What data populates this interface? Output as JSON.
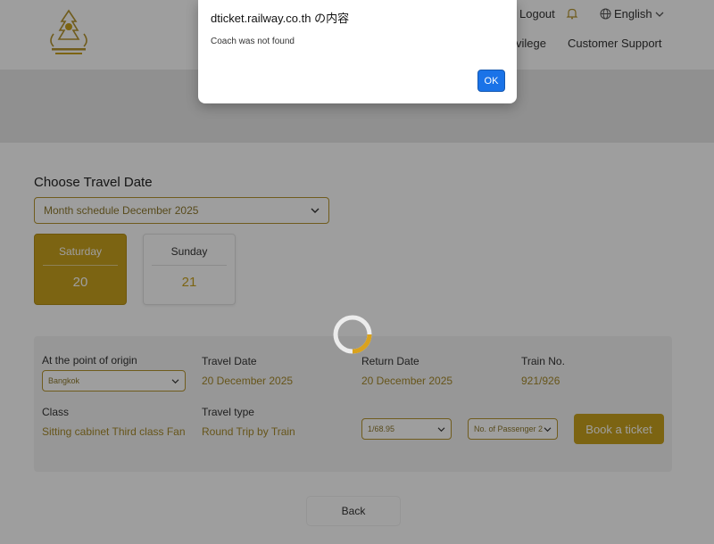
{
  "header": {
    "logout_label": "Logout",
    "language_label": "English",
    "nav_privilege_label": "vilege",
    "nav_support_label": "Customer Support"
  },
  "travel_date": {
    "section_title": "Choose Travel Date",
    "month_select_value": "Month schedule December 2025",
    "days": [
      {
        "name": "Saturday",
        "number": "20",
        "selected": true
      },
      {
        "name": "Sunday",
        "number": "21",
        "selected": false
      }
    ]
  },
  "booking": {
    "origin_label": "At the point of origin",
    "origin_value": "Bangkok",
    "travel_date_label": "Travel Date",
    "travel_date_value": "20 December 2025",
    "return_date_label": "Return Date",
    "return_date_value": "20 December 2025",
    "train_no_label": "Train No.",
    "train_no_value": "921/926",
    "class_label": "Class",
    "class_value": "Sitting cabinet Third class Fan",
    "travel_type_label": "Travel type",
    "travel_type_value": "Round Trip by Train",
    "fare_select_value": "1/68.95",
    "passenger_select_value": "No. of Passenger 2",
    "book_button_label": "Book a ticket"
  },
  "back_button_label": "Back",
  "dialog": {
    "title": "dticket.railway.co.th の内容",
    "message": "Coach was not found",
    "ok_label": "OK"
  },
  "colors": {
    "gold_accent": "#c9a21e",
    "dialog_button": "#1a73e8"
  }
}
